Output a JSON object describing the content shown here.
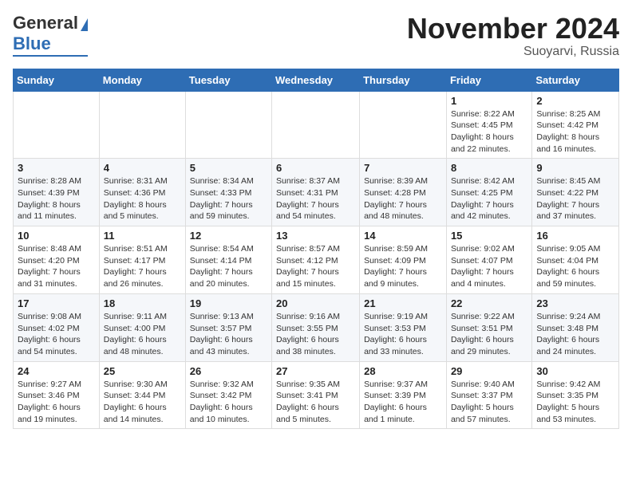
{
  "logo": {
    "line1": "General",
    "line2": "Blue"
  },
  "title": "November 2024",
  "subtitle": "Suoyarvi, Russia",
  "weekdays": [
    "Sunday",
    "Monday",
    "Tuesday",
    "Wednesday",
    "Thursday",
    "Friday",
    "Saturday"
  ],
  "weeks": [
    [
      {
        "day": "",
        "info": ""
      },
      {
        "day": "",
        "info": ""
      },
      {
        "day": "",
        "info": ""
      },
      {
        "day": "",
        "info": ""
      },
      {
        "day": "",
        "info": ""
      },
      {
        "day": "1",
        "info": "Sunrise: 8:22 AM\nSunset: 4:45 PM\nDaylight: 8 hours and 22 minutes."
      },
      {
        "day": "2",
        "info": "Sunrise: 8:25 AM\nSunset: 4:42 PM\nDaylight: 8 hours and 16 minutes."
      }
    ],
    [
      {
        "day": "3",
        "info": "Sunrise: 8:28 AM\nSunset: 4:39 PM\nDaylight: 8 hours and 11 minutes."
      },
      {
        "day": "4",
        "info": "Sunrise: 8:31 AM\nSunset: 4:36 PM\nDaylight: 8 hours and 5 minutes."
      },
      {
        "day": "5",
        "info": "Sunrise: 8:34 AM\nSunset: 4:33 PM\nDaylight: 7 hours and 59 minutes."
      },
      {
        "day": "6",
        "info": "Sunrise: 8:37 AM\nSunset: 4:31 PM\nDaylight: 7 hours and 54 minutes."
      },
      {
        "day": "7",
        "info": "Sunrise: 8:39 AM\nSunset: 4:28 PM\nDaylight: 7 hours and 48 minutes."
      },
      {
        "day": "8",
        "info": "Sunrise: 8:42 AM\nSunset: 4:25 PM\nDaylight: 7 hours and 42 minutes."
      },
      {
        "day": "9",
        "info": "Sunrise: 8:45 AM\nSunset: 4:22 PM\nDaylight: 7 hours and 37 minutes."
      }
    ],
    [
      {
        "day": "10",
        "info": "Sunrise: 8:48 AM\nSunset: 4:20 PM\nDaylight: 7 hours and 31 minutes."
      },
      {
        "day": "11",
        "info": "Sunrise: 8:51 AM\nSunset: 4:17 PM\nDaylight: 7 hours and 26 minutes."
      },
      {
        "day": "12",
        "info": "Sunrise: 8:54 AM\nSunset: 4:14 PM\nDaylight: 7 hours and 20 minutes."
      },
      {
        "day": "13",
        "info": "Sunrise: 8:57 AM\nSunset: 4:12 PM\nDaylight: 7 hours and 15 minutes."
      },
      {
        "day": "14",
        "info": "Sunrise: 8:59 AM\nSunset: 4:09 PM\nDaylight: 7 hours and 9 minutes."
      },
      {
        "day": "15",
        "info": "Sunrise: 9:02 AM\nSunset: 4:07 PM\nDaylight: 7 hours and 4 minutes."
      },
      {
        "day": "16",
        "info": "Sunrise: 9:05 AM\nSunset: 4:04 PM\nDaylight: 6 hours and 59 minutes."
      }
    ],
    [
      {
        "day": "17",
        "info": "Sunrise: 9:08 AM\nSunset: 4:02 PM\nDaylight: 6 hours and 54 minutes."
      },
      {
        "day": "18",
        "info": "Sunrise: 9:11 AM\nSunset: 4:00 PM\nDaylight: 6 hours and 48 minutes."
      },
      {
        "day": "19",
        "info": "Sunrise: 9:13 AM\nSunset: 3:57 PM\nDaylight: 6 hours and 43 minutes."
      },
      {
        "day": "20",
        "info": "Sunrise: 9:16 AM\nSunset: 3:55 PM\nDaylight: 6 hours and 38 minutes."
      },
      {
        "day": "21",
        "info": "Sunrise: 9:19 AM\nSunset: 3:53 PM\nDaylight: 6 hours and 33 minutes."
      },
      {
        "day": "22",
        "info": "Sunrise: 9:22 AM\nSunset: 3:51 PM\nDaylight: 6 hours and 29 minutes."
      },
      {
        "day": "23",
        "info": "Sunrise: 9:24 AM\nSunset: 3:48 PM\nDaylight: 6 hours and 24 minutes."
      }
    ],
    [
      {
        "day": "24",
        "info": "Sunrise: 9:27 AM\nSunset: 3:46 PM\nDaylight: 6 hours and 19 minutes."
      },
      {
        "day": "25",
        "info": "Sunrise: 9:30 AM\nSunset: 3:44 PM\nDaylight: 6 hours and 14 minutes."
      },
      {
        "day": "26",
        "info": "Sunrise: 9:32 AM\nSunset: 3:42 PM\nDaylight: 6 hours and 10 minutes."
      },
      {
        "day": "27",
        "info": "Sunrise: 9:35 AM\nSunset: 3:41 PM\nDaylight: 6 hours and 5 minutes."
      },
      {
        "day": "28",
        "info": "Sunrise: 9:37 AM\nSunset: 3:39 PM\nDaylight: 6 hours and 1 minute."
      },
      {
        "day": "29",
        "info": "Sunrise: 9:40 AM\nSunset: 3:37 PM\nDaylight: 5 hours and 57 minutes."
      },
      {
        "day": "30",
        "info": "Sunrise: 9:42 AM\nSunset: 3:35 PM\nDaylight: 5 hours and 53 minutes."
      }
    ]
  ]
}
